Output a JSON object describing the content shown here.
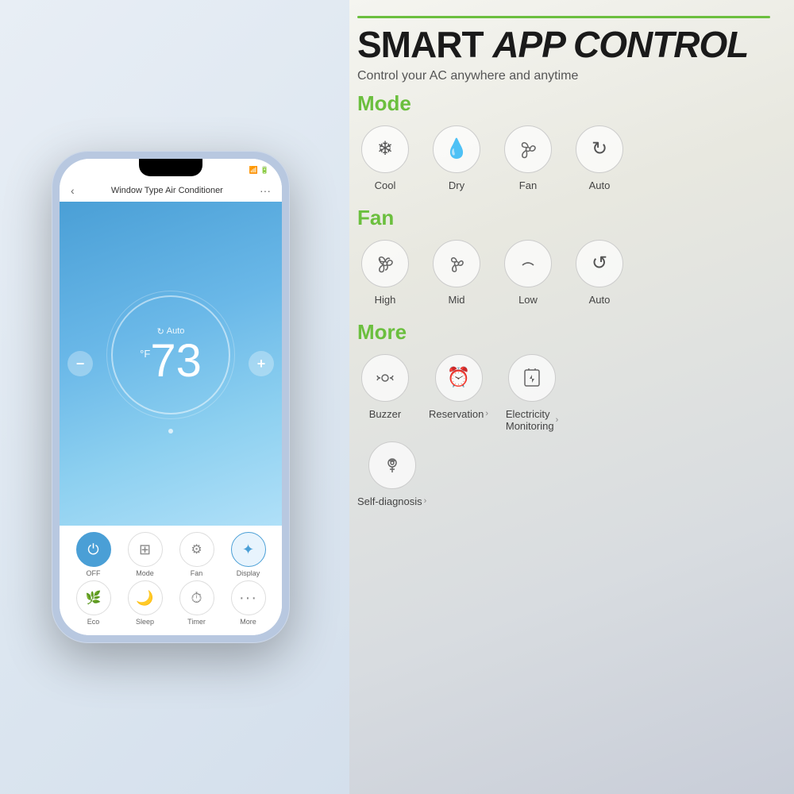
{
  "header": {
    "title_smart": "SMART ",
    "title_app": "APP CONTROL",
    "subtitle": "Control your AC anywhere and anytime"
  },
  "phone": {
    "status_bar": "▌▌ ▊",
    "title": "Window Type Air Conditioner",
    "back_icon": "‹",
    "more_icon": "···",
    "mode_label": "Auto",
    "temp_value": "73",
    "temp_unit": "°F",
    "dot": "·",
    "controls": {
      "row1": [
        {
          "label": "OFF",
          "icon": "⏻",
          "active": "blue"
        },
        {
          "label": "Mode",
          "icon": "⊞",
          "active": "none"
        },
        {
          "label": "Fan",
          "icon": "✿",
          "active": "none"
        },
        {
          "label": "Display",
          "icon": "💡",
          "active": "light"
        }
      ],
      "row2": [
        {
          "label": "Eco",
          "icon": "🌿",
          "active": "none"
        },
        {
          "label": "Sleep",
          "icon": "🌙",
          "active": "none"
        },
        {
          "label": "Timer",
          "icon": "⏱",
          "active": "none"
        },
        {
          "label": "More",
          "icon": "···",
          "active": "none"
        }
      ]
    }
  },
  "sections": {
    "mode": {
      "title": "Mode",
      "items": [
        {
          "label": "Cool",
          "icon": "❄"
        },
        {
          "label": "Dry",
          "icon": "💧"
        },
        {
          "label": "Fan",
          "icon": "✿"
        },
        {
          "label": "Auto",
          "icon": "↻"
        }
      ]
    },
    "fan": {
      "title": "Fan",
      "items": [
        {
          "label": "High",
          "icon": "✾"
        },
        {
          "label": "Mid",
          "icon": "✿"
        },
        {
          "label": "Low",
          "icon": "⌒"
        },
        {
          "label": "Auto",
          "icon": "↺"
        }
      ]
    },
    "more": {
      "title": "More",
      "row1": [
        {
          "label": "Buzzer",
          "icon": "📶",
          "arrow": false
        },
        {
          "label": "Reservation",
          "icon": "⏰",
          "arrow": true
        },
        {
          "label": "Electricity\nMonitoring",
          "icon": "🔋",
          "arrow": true
        }
      ],
      "row2": [
        {
          "label": "Self-diagnosis",
          "icon": "🩺",
          "arrow": true
        }
      ]
    }
  },
  "colors": {
    "green_accent": "#6bbf3e",
    "blue_primary": "#4a9fd6",
    "text_dark": "#1a1a1a",
    "text_muted": "#555"
  }
}
